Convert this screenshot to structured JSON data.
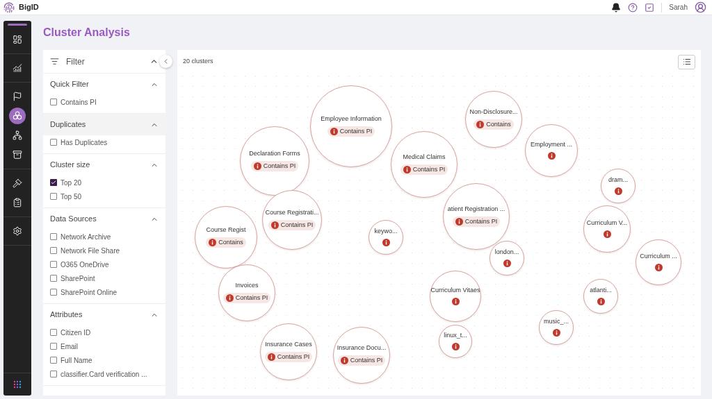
{
  "header": {
    "brand": "BigID",
    "user_name": "Sarah"
  },
  "nav": [
    {
      "selected": false
    },
    {
      "selected": false
    },
    {
      "selected": false
    },
    {
      "selected": true
    },
    {
      "selected": false
    },
    {
      "selected": false
    },
    {
      "selected": false
    },
    {
      "selected": false
    },
    {
      "selected": false
    }
  ],
  "page_title": "Cluster Analysis",
  "filter": {
    "title": "Filter",
    "expanded": true,
    "sections": [
      {
        "title": "Quick Filter",
        "expanded": true,
        "highlighted": false,
        "options": [
          {
            "label": "Contains PI",
            "checked": false
          }
        ]
      },
      {
        "title": "Duplicates",
        "expanded": true,
        "highlighted": true,
        "options": [
          {
            "label": "Has Duplicates",
            "checked": false
          }
        ]
      },
      {
        "title": "Cluster size",
        "expanded": true,
        "highlighted": false,
        "options": [
          {
            "label": "Top 20",
            "checked": true
          },
          {
            "label": "Top 50",
            "checked": false
          }
        ]
      },
      {
        "title": "Data Sources",
        "expanded": true,
        "highlighted": false,
        "options": [
          {
            "label": "Network Archive",
            "checked": false
          },
          {
            "label": "Network File Share",
            "checked": false
          },
          {
            "label": "O365 OneDrive",
            "checked": false
          },
          {
            "label": "SharePoint",
            "checked": false
          },
          {
            "label": "SharePoint Online",
            "checked": false
          }
        ]
      },
      {
        "title": "Attributes",
        "expanded": true,
        "highlighted": false,
        "options": [
          {
            "label": "Citizen ID",
            "checked": false
          },
          {
            "label": "Email",
            "checked": false
          },
          {
            "label": "Full Name",
            "checked": false
          },
          {
            "label": "classifier.Card verification ...",
            "checked": false
          }
        ]
      }
    ]
  },
  "canvas": {
    "count": "20 clusters",
    "clusters": [
      {
        "label": "Non-Disclosure...",
        "badge": "Contains"
      },
      {
        "label": "Employee Information",
        "badge": "Contains PI"
      },
      {
        "label": "Employment ..."
      },
      {
        "label": "Declaration Forms",
        "badge": "Contains PI"
      },
      {
        "label": "Medical Claims",
        "badge": "Contains PI"
      },
      {
        "label": "dram..."
      },
      {
        "label": "atient Registration ...",
        "badge": "Contains PI"
      },
      {
        "label": "Course Registrati...",
        "badge": "Contains PI"
      },
      {
        "label": "Curriculum V..."
      },
      {
        "label": "Course Regist",
        "badge": "Contains"
      },
      {
        "label": "keywo..."
      },
      {
        "label": "london..."
      },
      {
        "label": "Curriculum ..."
      },
      {
        "label": "Invoices",
        "badge": "Contains PI"
      },
      {
        "label": "Curriculum Vitaes"
      },
      {
        "label": "atlanti..."
      },
      {
        "label": "music_..."
      },
      {
        "label": "linux_t..."
      },
      {
        "label": "Insurance Cases",
        "badge": "Contains PI"
      },
      {
        "label": "Insurance Docu...",
        "badge": "Contains PI"
      }
    ]
  }
}
